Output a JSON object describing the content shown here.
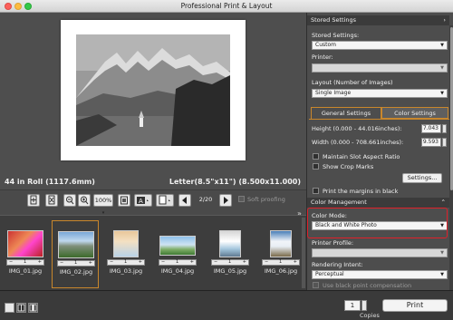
{
  "window": {
    "title": "Professional Print & Layout"
  },
  "preview": {
    "roll_label": "44 in Roll (1117.6mm)",
    "paper_label": "Letter(8.5\"x11\") (8.500x11.000)"
  },
  "toolbar": {
    "zoom_value": "100%",
    "page_indicator": "2/20",
    "soft_proofing_label": "Soft proofing"
  },
  "thumbnails": [
    {
      "name": "IMG_01.jpg",
      "count": "1",
      "selected": false
    },
    {
      "name": "IMG_02.jpg",
      "count": "1",
      "selected": true
    },
    {
      "name": "IMG_03.jpg",
      "count": "1",
      "selected": false
    },
    {
      "name": "IMG_04.jpg",
      "count": "1",
      "selected": false
    },
    {
      "name": "IMG_05.jpg",
      "count": "1",
      "selected": false
    },
    {
      "name": "IMG_06.jpg",
      "count": "1",
      "selected": false
    }
  ],
  "bottom": {
    "copies_value": "1",
    "copies_label": "Copies",
    "print_label": "Print"
  },
  "panel": {
    "stored_settings_header": "Stored Settings",
    "stored_settings_label": "Stored Settings:",
    "stored_settings_value": "Custom",
    "printer_label": "Printer:",
    "printer_value": "",
    "layout_label": "Layout (Number of Images)",
    "layout_value": "Single Image",
    "tab_general": "General Settings",
    "tab_color": "Color Settings",
    "height_label": "Height (0.000 - 44.016inches):",
    "height_value": "7.043",
    "width_label": "Width (0.000 - 708.661inches):",
    "width_value": "9.593",
    "maintain_aspect_label": "Maintain Slot Aspect Ratio",
    "show_crop_label": "Show Crop Marks",
    "settings_button": "Settings...",
    "print_margins_label": "Print the margins in black",
    "color_management_header": "Color Management",
    "color_mode_label": "Color Mode:",
    "color_mode_value": "Black and White Photo",
    "printer_profile_label": "Printer Profile:",
    "printer_profile_value": "",
    "rendering_intent_label": "Rendering Intent:",
    "rendering_intent_value": "Perceptual",
    "black_point_label": "Use black point compensation"
  },
  "colors": {
    "accent": "#c9872c",
    "highlight": "#e0202a",
    "panel_bg": "#4d4d4d"
  }
}
